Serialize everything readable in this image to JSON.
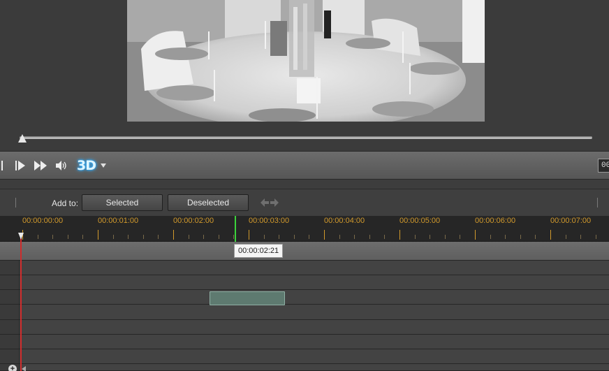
{
  "preview": {
    "video_description_icon": "video-frame"
  },
  "player": {
    "mode_3d_label": "3D",
    "timecode_partial": "00"
  },
  "addbar": {
    "label": "Add to:",
    "selected_label": "Selected",
    "deselected_label": "Deselected"
  },
  "ruler": {
    "labels": [
      "00:00:00:00",
      "00:00:01:00",
      "00:00:02:00",
      "00:00:03:00",
      "00:00:04:00",
      "00:00:05:00",
      "00:00:06:00",
      "00:00:07:00"
    ]
  },
  "timeline": {
    "current_time_tooltip": "00:00:02:21"
  },
  "colors": {
    "ruler_text": "#d29a2c",
    "current_indicator": "#3bd33b",
    "playhead": "#d02c2c",
    "clip": "#5e7a70"
  }
}
